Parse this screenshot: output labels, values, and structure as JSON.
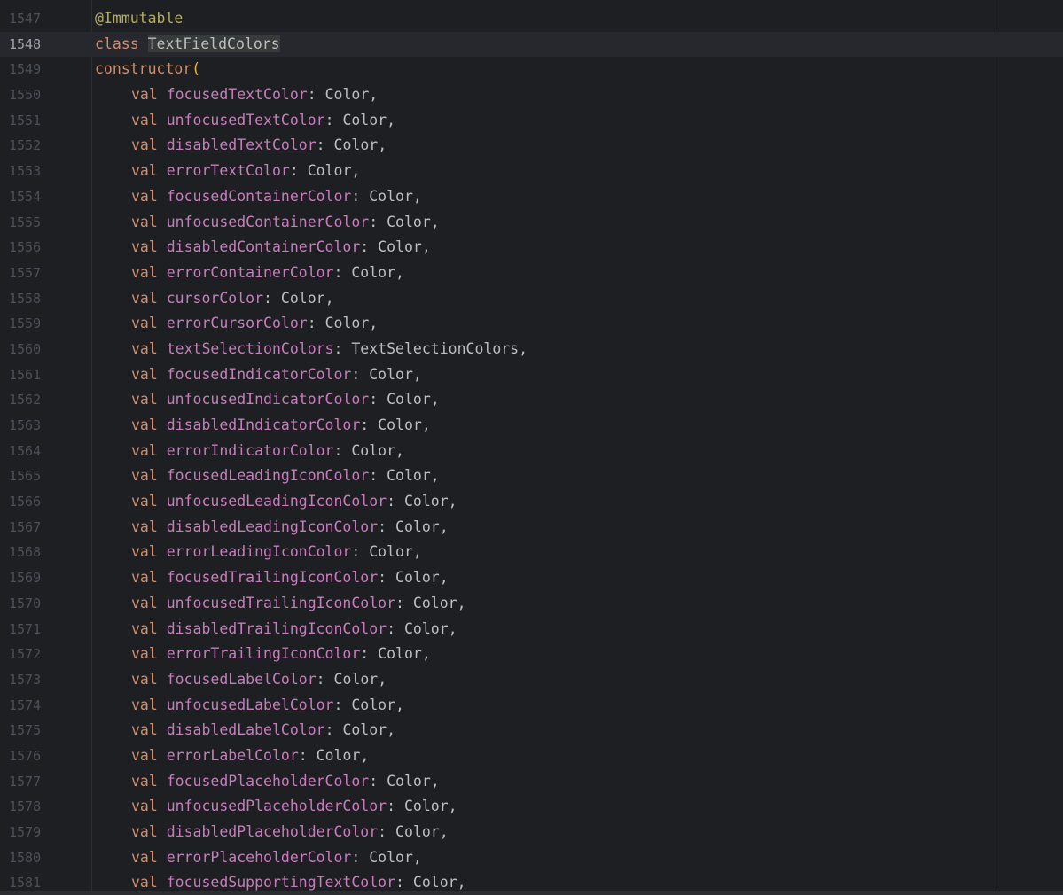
{
  "editor": {
    "lines": [
      {
        "num": "1547",
        "kind": "annotation",
        "text": "@Immutable"
      },
      {
        "num": "1548",
        "kind": "class",
        "keyword": "class",
        "name": "TextFieldColors",
        "current": true
      },
      {
        "num": "1549",
        "kind": "ctor",
        "keyword": "constructor",
        "paren": "("
      },
      {
        "num": "1550",
        "kind": "param",
        "kw": "val",
        "name": "focusedTextColor",
        "type": "Color"
      },
      {
        "num": "1551",
        "kind": "param",
        "kw": "val",
        "name": "unfocusedTextColor",
        "type": "Color"
      },
      {
        "num": "1552",
        "kind": "param",
        "kw": "val",
        "name": "disabledTextColor",
        "type": "Color"
      },
      {
        "num": "1553",
        "kind": "param",
        "kw": "val",
        "name": "errorTextColor",
        "type": "Color"
      },
      {
        "num": "1554",
        "kind": "param",
        "kw": "val",
        "name": "focusedContainerColor",
        "type": "Color"
      },
      {
        "num": "1555",
        "kind": "param",
        "kw": "val",
        "name": "unfocusedContainerColor",
        "type": "Color"
      },
      {
        "num": "1556",
        "kind": "param",
        "kw": "val",
        "name": "disabledContainerColor",
        "type": "Color"
      },
      {
        "num": "1557",
        "kind": "param",
        "kw": "val",
        "name": "errorContainerColor",
        "type": "Color"
      },
      {
        "num": "1558",
        "kind": "param",
        "kw": "val",
        "name": "cursorColor",
        "type": "Color"
      },
      {
        "num": "1559",
        "kind": "param",
        "kw": "val",
        "name": "errorCursorColor",
        "type": "Color"
      },
      {
        "num": "1560",
        "kind": "param",
        "kw": "val",
        "name": "textSelectionColors",
        "type": "TextSelectionColors"
      },
      {
        "num": "1561",
        "kind": "param",
        "kw": "val",
        "name": "focusedIndicatorColor",
        "type": "Color"
      },
      {
        "num": "1562",
        "kind": "param",
        "kw": "val",
        "name": "unfocusedIndicatorColor",
        "type": "Color"
      },
      {
        "num": "1563",
        "kind": "param",
        "kw": "val",
        "name": "disabledIndicatorColor",
        "type": "Color"
      },
      {
        "num": "1564",
        "kind": "param",
        "kw": "val",
        "name": "errorIndicatorColor",
        "type": "Color"
      },
      {
        "num": "1565",
        "kind": "param",
        "kw": "val",
        "name": "focusedLeadingIconColor",
        "type": "Color"
      },
      {
        "num": "1566",
        "kind": "param",
        "kw": "val",
        "name": "unfocusedLeadingIconColor",
        "type": "Color"
      },
      {
        "num": "1567",
        "kind": "param",
        "kw": "val",
        "name": "disabledLeadingIconColor",
        "type": "Color"
      },
      {
        "num": "1568",
        "kind": "param",
        "kw": "val",
        "name": "errorLeadingIconColor",
        "type": "Color"
      },
      {
        "num": "1569",
        "kind": "param",
        "kw": "val",
        "name": "focusedTrailingIconColor",
        "type": "Color"
      },
      {
        "num": "1570",
        "kind": "param",
        "kw": "val",
        "name": "unfocusedTrailingIconColor",
        "type": "Color"
      },
      {
        "num": "1571",
        "kind": "param",
        "kw": "val",
        "name": "disabledTrailingIconColor",
        "type": "Color"
      },
      {
        "num": "1572",
        "kind": "param",
        "kw": "val",
        "name": "errorTrailingIconColor",
        "type": "Color"
      },
      {
        "num": "1573",
        "kind": "param",
        "kw": "val",
        "name": "focusedLabelColor",
        "type": "Color"
      },
      {
        "num": "1574",
        "kind": "param",
        "kw": "val",
        "name": "unfocusedLabelColor",
        "type": "Color"
      },
      {
        "num": "1575",
        "kind": "param",
        "kw": "val",
        "name": "disabledLabelColor",
        "type": "Color"
      },
      {
        "num": "1576",
        "kind": "param",
        "kw": "val",
        "name": "errorLabelColor",
        "type": "Color"
      },
      {
        "num": "1577",
        "kind": "param",
        "kw": "val",
        "name": "focusedPlaceholderColor",
        "type": "Color"
      },
      {
        "num": "1578",
        "kind": "param",
        "kw": "val",
        "name": "unfocusedPlaceholderColor",
        "type": "Color"
      },
      {
        "num": "1579",
        "kind": "param",
        "kw": "val",
        "name": "disabledPlaceholderColor",
        "type": "Color"
      },
      {
        "num": "1580",
        "kind": "param",
        "kw": "val",
        "name": "errorPlaceholderColor",
        "type": "Color"
      },
      {
        "num": "1581",
        "kind": "param",
        "kw": "val",
        "name": "focusedSupportingTextColor",
        "type": "Color"
      }
    ],
    "colors": {
      "background": "#1e1f22",
      "line_number": "#4b5059",
      "keyword": "#cf8e6d",
      "property": "#c77dbb",
      "annotation": "#b3ae60",
      "paren": "#e8ba36",
      "text": "#bcbec4"
    }
  }
}
